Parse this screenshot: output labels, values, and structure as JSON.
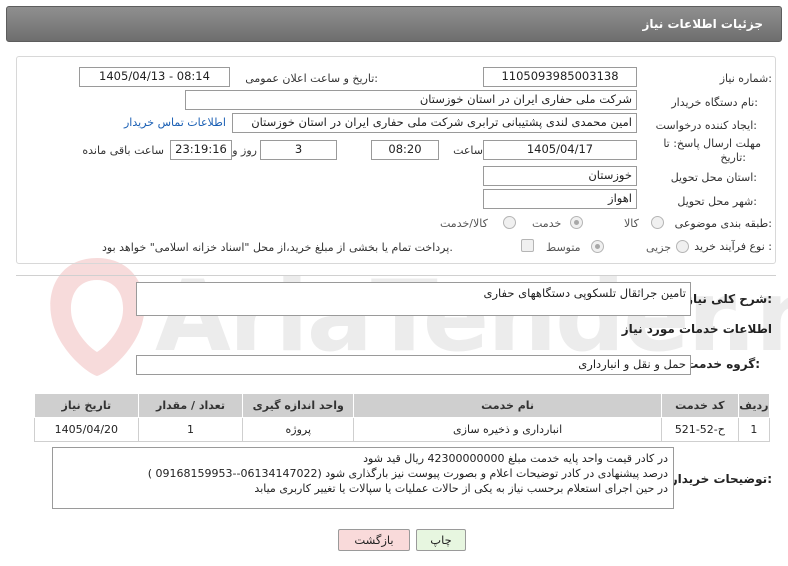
{
  "header": {
    "title": "جزئیات اطلاعات نیاز"
  },
  "form": {
    "need_number_label": "شماره نیاز:",
    "need_number": "1105093985003138",
    "announce_label": "تاریخ و ساعت اعلان عمومی:",
    "announce_value": "1405/04/13 - 08:14",
    "buyer_org_label": "نام دستگاه خریدار:",
    "buyer_org": "شرکت ملی حفاری ایران در استان خوزستان",
    "creator_label": "ایجاد کننده درخواست:",
    "creator": "امین محمدی لندی پشتیبانی ترابری شرکت ملی حفاری ایران در استان خوزستان",
    "contact_link": "اطلاعات تماس خریدار",
    "deadline_label_1": "مهلت ارسال پاسخ: تا",
    "deadline_label_2": "تاریخ:",
    "deadline_date": "1405/04/17",
    "time_label": "ساعت",
    "deadline_time": "08:20",
    "days_value": "3",
    "days_label": "روز و",
    "remaining_time": "23:19:16",
    "remaining_label": "ساعت باقی مانده",
    "province_label": "استان محل تحویل:",
    "province": "خوزستان",
    "city_label": "شهر محل تحویل:",
    "city": "اهواز",
    "category_label": "طبقه بندی موضوعی:",
    "category_options": [
      "کالا",
      "خدمت",
      "کالا/خدمت"
    ],
    "category_selected": "خدمت",
    "process_label": "نوع فرآیند خرید :",
    "process_options": [
      "جزیی",
      "متوسط"
    ],
    "process_selected": "متوسط",
    "payment_note": "پرداخت تمام یا بخشی از مبلغ خرید،از محل \"اسناد خزانه اسلامی\" خواهد بود."
  },
  "summary": {
    "label": "شرح کلی نیاز:",
    "value": "تامین جراثقال تلسکوپی دستگاههای حفاری"
  },
  "services_section": {
    "title": "اطلاعات خدمات مورد نیاز",
    "group_label": "گروه خدمت:",
    "group_value": "حمل و نقل و انبارداری"
  },
  "table": {
    "headers": [
      "ردیف",
      "کد خدمت",
      "نام خدمت",
      "واحد اندازه گیری",
      "تعداد / مقدار",
      "تاریخ نیاز"
    ],
    "rows": [
      [
        "1",
        "ح-52-521",
        "انبارداری و ذخیره سازی",
        "پروژه",
        "1",
        "1405/04/20"
      ]
    ]
  },
  "buyer_notes": {
    "label": "توضیحات خریدار:",
    "lines": [
      "در کادر قیمت واحد پایه خدمت مبلغ 42300000000 ریال قید شود",
      "درصد پیشنهادی در کادر توضیحات اعلام و بصورت پیوست نیز بارگذاری شود (06134147022--09168159953 )",
      "در حین اجرای استعلام  برحسب نیاز به یکی از حالات عملیات یا سپالات یا  تغییر کاربری میابد"
    ]
  },
  "buttons": {
    "print": "چاپ",
    "back": "بازگشت"
  },
  "colors": {
    "header_bg": "#7d7d7d",
    "link": "#1a5fb4",
    "back_button_bg": "#f9dada",
    "print_button_bg": "#e7f6e0"
  },
  "watermark": {
    "text": "AriaTender.neT"
  }
}
